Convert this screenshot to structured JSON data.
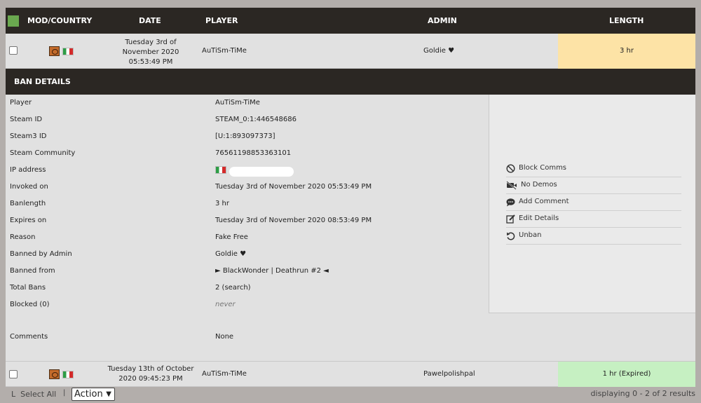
{
  "header": {
    "mod_country": "MOD/COUNTRY",
    "date": "DATE",
    "player": "PLAYER",
    "admin": "ADMIN",
    "length": "LENGTH"
  },
  "bans": [
    {
      "date_line1": "Tuesday 3rd of",
      "date_line2": "November 2020",
      "date_line3": "05:53:49 PM",
      "player": "AuTiSm-TiMe",
      "admin": "Goldie ♥",
      "length": "3 hr",
      "length_color": "#fde3a6"
    },
    {
      "date_line1": "Tuesday 13th of October",
      "date_line2": "2020 09:45:23 PM",
      "player": "AuTiSm-TiMe",
      "admin": "Pawelpolishpal",
      "length": "1 hr (Expired)",
      "length_color": "#c6f0c2"
    }
  ],
  "details": {
    "title": "BAN DETAILS",
    "rows": [
      {
        "key": "Player",
        "value": "AuTiSm-TiMe"
      },
      {
        "key": "Steam ID",
        "value": "STEAM_0:1:446548686"
      },
      {
        "key": "Steam3 ID",
        "value": "[U:1:893097373]"
      },
      {
        "key": "Steam Community",
        "value": "76561198853363101"
      },
      {
        "key": "IP address",
        "value": ""
      },
      {
        "key": "Invoked on",
        "value": "Tuesday 3rd of November 2020 05:53:49 PM"
      },
      {
        "key": "Banlength",
        "value": "3 hr"
      },
      {
        "key": "Expires on",
        "value": "Tuesday 3rd of November 2020 08:53:49 PM"
      },
      {
        "key": "Reason",
        "value": "Fake Free"
      },
      {
        "key": "Banned by Admin",
        "value": "Goldie ♥"
      },
      {
        "key": "Banned from",
        "value": "► BlackWonder | Deathrun #2 ◄"
      },
      {
        "key": "Total Bans",
        "value": "2 (search)"
      },
      {
        "key": "Blocked (0)",
        "value": "never"
      },
      {
        "key": "Comments",
        "value": "None"
      }
    ],
    "actions": [
      {
        "label": "Block Comms",
        "icon": "ban-icon"
      },
      {
        "label": "No Demos",
        "icon": "video-off-icon"
      },
      {
        "label": "Add Comment",
        "icon": "comment-icon"
      },
      {
        "label": "Edit Details",
        "icon": "edit-icon"
      },
      {
        "label": "Unban",
        "icon": "undo-icon"
      }
    ]
  },
  "footer": {
    "corner": "L",
    "select_all": "Select All",
    "separator": "|",
    "action_select": "Action",
    "displaying": "displaying 0 - 2 of 2 results"
  },
  "colors": {
    "header_bg": "#2b2723",
    "accent_green": "#6aa84f",
    "active_length": "#fde3a6",
    "expired_length": "#c6f0c2"
  }
}
